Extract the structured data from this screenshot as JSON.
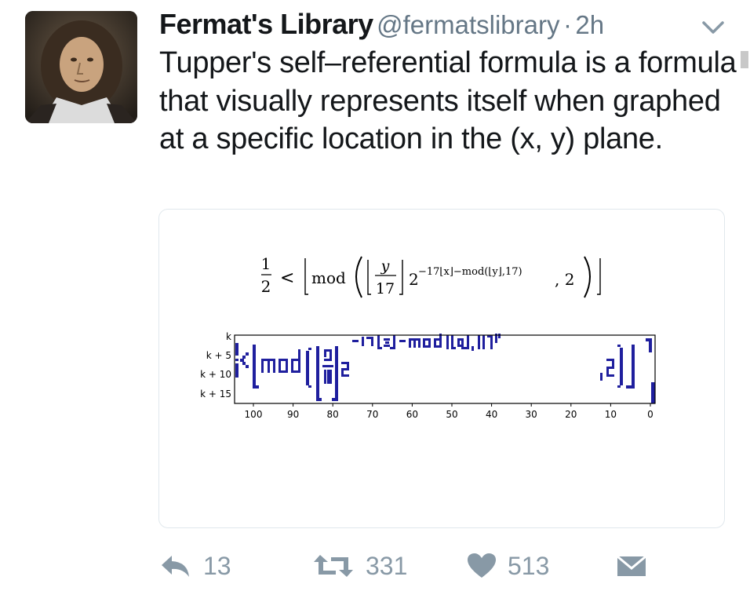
{
  "tweet": {
    "author_name": "Fermat's Library",
    "handle": "@fermatslibrary",
    "separator": "·",
    "time": "2h",
    "text": "Tupper's self–referential formula is a formula that visually represents itself when graphed at a specific location in the (x, y) plane."
  },
  "formula": {
    "lhs_num": "1",
    "lhs_den": "2",
    "op": "<",
    "fn": "mod",
    "frac_num": "y",
    "frac_den": "17",
    "base": "2",
    "exponent": "−17⌊x⌋−mod(⌊y⌋,17)",
    "modulus": ", 2"
  },
  "plot": {
    "y_ticks": [
      "k",
      "k + 5",
      "k + 10",
      "k + 15"
    ],
    "x_ticks": [
      "100",
      "90",
      "80",
      "70",
      "60",
      "50",
      "40",
      "30",
      "20",
      "10",
      "0"
    ]
  },
  "actions": {
    "reply_count": "13",
    "retweet_count": "331",
    "like_count": "513"
  },
  "colors": {
    "pixel_blue": "#1f1f9e",
    "icon_gray": "#8899a6",
    "card_border": "#e1e8ed"
  },
  "icons": {
    "caret": "chevron-down-icon",
    "reply": "reply-icon",
    "retweet": "retweet-icon",
    "like": "heart-icon",
    "dm": "envelope-icon"
  }
}
